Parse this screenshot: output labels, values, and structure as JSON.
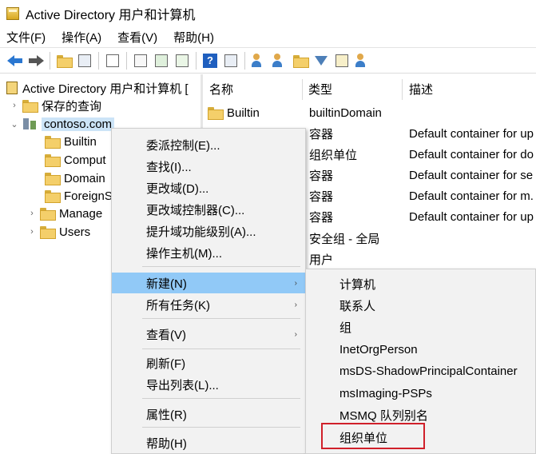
{
  "window": {
    "title": "Active Directory 用户和计算机"
  },
  "menubar": {
    "items": [
      "文件(F)",
      "操作(A)",
      "查看(V)",
      "帮助(H)"
    ]
  },
  "tree": {
    "root": "Active Directory 用户和计算机 [",
    "saved_queries": "保存的查询",
    "domain": "contoso.com",
    "children": [
      "Builtin",
      "Comput",
      "Domain",
      "ForeignS",
      "Manage",
      "Users"
    ]
  },
  "list": {
    "columns": {
      "name": "名称",
      "type": "类型",
      "description": "描述"
    },
    "rows": [
      {
        "name": "Builtin",
        "type": "builtinDomain",
        "description": ""
      },
      {
        "name": "",
        "type": "容器",
        "description": "Default container for up"
      },
      {
        "name": "",
        "type": "组织单位",
        "description": "Default container for do"
      },
      {
        "name": "",
        "type": "容器",
        "description": "Default container for se"
      },
      {
        "name": "",
        "type": "容器",
        "description": "Default container for m."
      },
      {
        "name": "",
        "type": "容器",
        "description": "Default container for up"
      },
      {
        "name": "",
        "type": "安全组 - 全局",
        "description": ""
      },
      {
        "name": "",
        "type": "用户",
        "description": ""
      }
    ]
  },
  "context_menu": {
    "items": [
      "委派控制(E)...",
      "查找(I)...",
      "更改域(D)...",
      "更改域控制器(C)...",
      "提升域功能级别(A)...",
      "操作主机(M)...",
      "新建(N)",
      "所有任务(K)",
      "查看(V)",
      "刷新(F)",
      "导出列表(L)...",
      "属性(R)",
      "帮助(H)"
    ],
    "highlighted": "新建(N)"
  },
  "submenu": {
    "items": [
      "计算机",
      "联系人",
      "组",
      "InetOrgPerson",
      "msDS-ShadowPrincipalContainer",
      "msImaging-PSPs",
      "MSMQ 队列别名",
      "组织单位"
    ],
    "emphasized": "组织单位"
  },
  "colors": {
    "highlight": "#91c9f7",
    "tree_selection": "#cce4f7",
    "callout_border": "#d0202a"
  }
}
